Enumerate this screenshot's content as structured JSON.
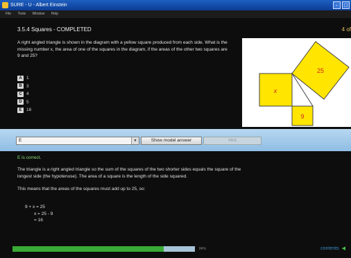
{
  "window": {
    "title": "SURE - U - Albert Einstein",
    "buttons": [
      "-",
      "□"
    ]
  },
  "menu": [
    "File",
    "Tools",
    "Window",
    "Help"
  ],
  "heading": "3.5.4 Squares - COMPLETED",
  "counter": "4 of",
  "question": "A right angled triangle is shown in the diagram with a yellow square produced from each side. What is the missing number x, the area of one of the squares in the diagram, if the areas of the other two squares are 9 and 25?",
  "options": [
    {
      "key": "A",
      "text": "1"
    },
    {
      "key": "B",
      "text": "3"
    },
    {
      "key": "C",
      "text": "4"
    },
    {
      "key": "D",
      "text": "5"
    },
    {
      "key": "E",
      "text": "16"
    }
  ],
  "diagram": {
    "label_x": "x",
    "label_25": "25",
    "label_9": "9",
    "fill": "#ffe500",
    "stroke": "#444444",
    "x_color": "#d31f1f"
  },
  "answer": {
    "selected": "E",
    "show_model_label": "Show model answer",
    "hint_label": "Hint"
  },
  "feedback": "E is correct.",
  "explanation": [
    "The triangle is a right angled triangle so the sum of the squares of the two shorter sides equals the square of the longest side (the hypotenuse). The area of a square is the length of the side squared.",
    "This means that the areas of the squares must add up to 25, so:"
  ],
  "working": [
    "9 + x = 25",
    "x = 25 - 9",
    "= 16"
  ],
  "progress": {
    "fraction": 0.83,
    "label": "84%",
    "color": "#3aa935"
  },
  "contents_label": "contents"
}
